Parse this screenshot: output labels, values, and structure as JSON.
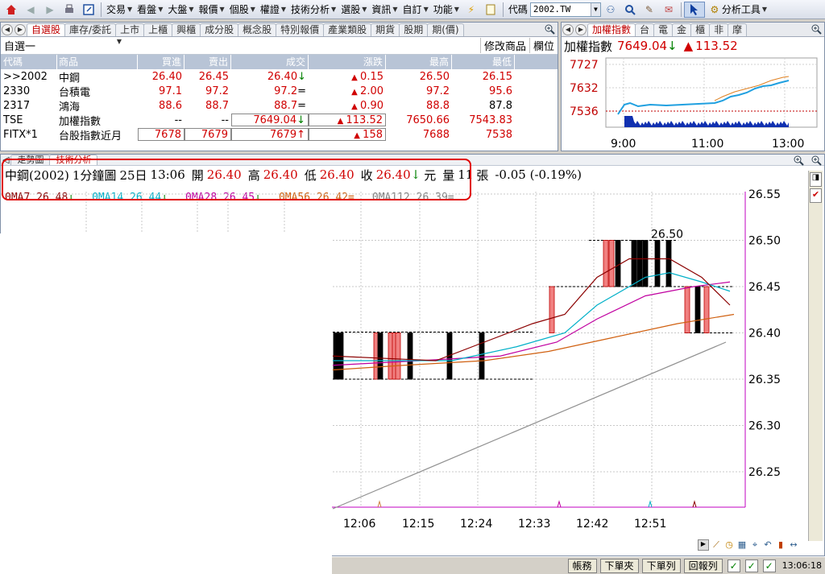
{
  "toolbar": {
    "items": [
      "交易",
      "看盤",
      "大盤",
      "報價",
      "個股",
      "權證",
      "技術分析",
      "選股",
      "資訊",
      "自訂",
      "功能"
    ],
    "code_label": "代碼",
    "code_value": "2002.TW",
    "analysis_tool": "分析工具"
  },
  "watchlist": {
    "tabs": [
      "自選股",
      "庫存/委託",
      "上市",
      "上櫃",
      "興櫃",
      "成分股",
      "概念股",
      "特別報價",
      "產業類股",
      "期貨",
      "股期",
      "期(價)"
    ],
    "active_tab": "自選股",
    "group_name": "自選一",
    "modify_label": "修改商品",
    "column_label": "欄位",
    "headers": [
      "代碼",
      "商品",
      "買進",
      "賣出",
      "成交",
      "漲跌",
      "最高",
      "最低"
    ],
    "rows": [
      {
        "code": ">>2002",
        "name": "中鋼",
        "bid": "26.40",
        "ask": "26.45",
        "last": "26.40",
        "last_mark": "↓",
        "change": "0.15",
        "high": "26.50",
        "low": "26.15"
      },
      {
        "code": "2330",
        "name": "台積電",
        "bid": "97.1",
        "ask": "97.2",
        "last": "97.2",
        "last_mark": "=",
        "change": "2.00",
        "high": "97.2",
        "low": "95.6"
      },
      {
        "code": "2317",
        "name": "鴻海",
        "bid": "88.6",
        "ask": "88.7",
        "last": "88.7",
        "last_mark": "=",
        "change": "0.90",
        "high": "88.8",
        "low": "87.8"
      },
      {
        "code": "TSE",
        "name": "加權指數",
        "bid": "--",
        "ask": "--",
        "last": "7649.04",
        "last_mark": "↓",
        "change": "113.52",
        "high": "7650.66",
        "low": "7543.83"
      },
      {
        "code": "FITX*1",
        "name": "台股指數近月",
        "bid": "7678",
        "ask": "7679",
        "last": "7679",
        "last_mark": "↑",
        "change": "158",
        "high": "7688",
        "low": "7538"
      }
    ]
  },
  "index_panel": {
    "tabs": [
      "加權指數",
      "台",
      "電",
      "金",
      "櫃",
      "非",
      "摩"
    ],
    "title": "加權指數",
    "value": "7649.04",
    "value_mark": "↓",
    "change_mark": "▲",
    "change": "113.52",
    "y_ticks": [
      "7727",
      "7632",
      "7536"
    ],
    "x_ticks": [
      "9:00",
      "11:00",
      "13:00"
    ]
  },
  "tech": {
    "tabs": [
      "走勢圖",
      "技術分析"
    ],
    "active_tab": "技術分析",
    "info": {
      "name": "中鋼(2002)",
      "period": "1分鐘圖",
      "date": "25日",
      "time": "13:06",
      "open_label": "開",
      "open": "26.40",
      "high_label": "高",
      "high": "26.40",
      "low_label": "低",
      "low": "26.40",
      "close_label": "收",
      "close": "26.40",
      "close_mark": "↓",
      "unit": "元",
      "vol_label": "量",
      "vol": "11",
      "vol_unit": "張",
      "change": "-0.05 (-0.19%)"
    },
    "ma_labels": [
      {
        "text": "0MA7 26.48",
        "mark": "↓",
        "color": "#8b0000"
      },
      {
        "text": "0MA14 26.44",
        "mark": "↓",
        "color": "#00b0c8"
      },
      {
        "text": "0MA28 26.45",
        "mark": "↓",
        "color": "#c000a0"
      },
      {
        "text": "0MA56 26.42",
        "mark": "=",
        "color": "#d06010"
      },
      {
        "text": "0MA112 26.39",
        "mark": "=",
        "color": "#808080"
      }
    ],
    "y_ticks": [
      "26.55",
      "26.50",
      "26.45",
      "26.40",
      "26.35",
      "26.30",
      "26.25"
    ],
    "x_ticks": [
      "12:06",
      "12:15",
      "12:24",
      "12:33",
      "12:42",
      "12:51"
    ],
    "peak_label": "26.50"
  },
  "status": {
    "buttons": [
      "帳務",
      "下單夾",
      "下單列",
      "回報列"
    ],
    "time": "13:06:18"
  }
}
